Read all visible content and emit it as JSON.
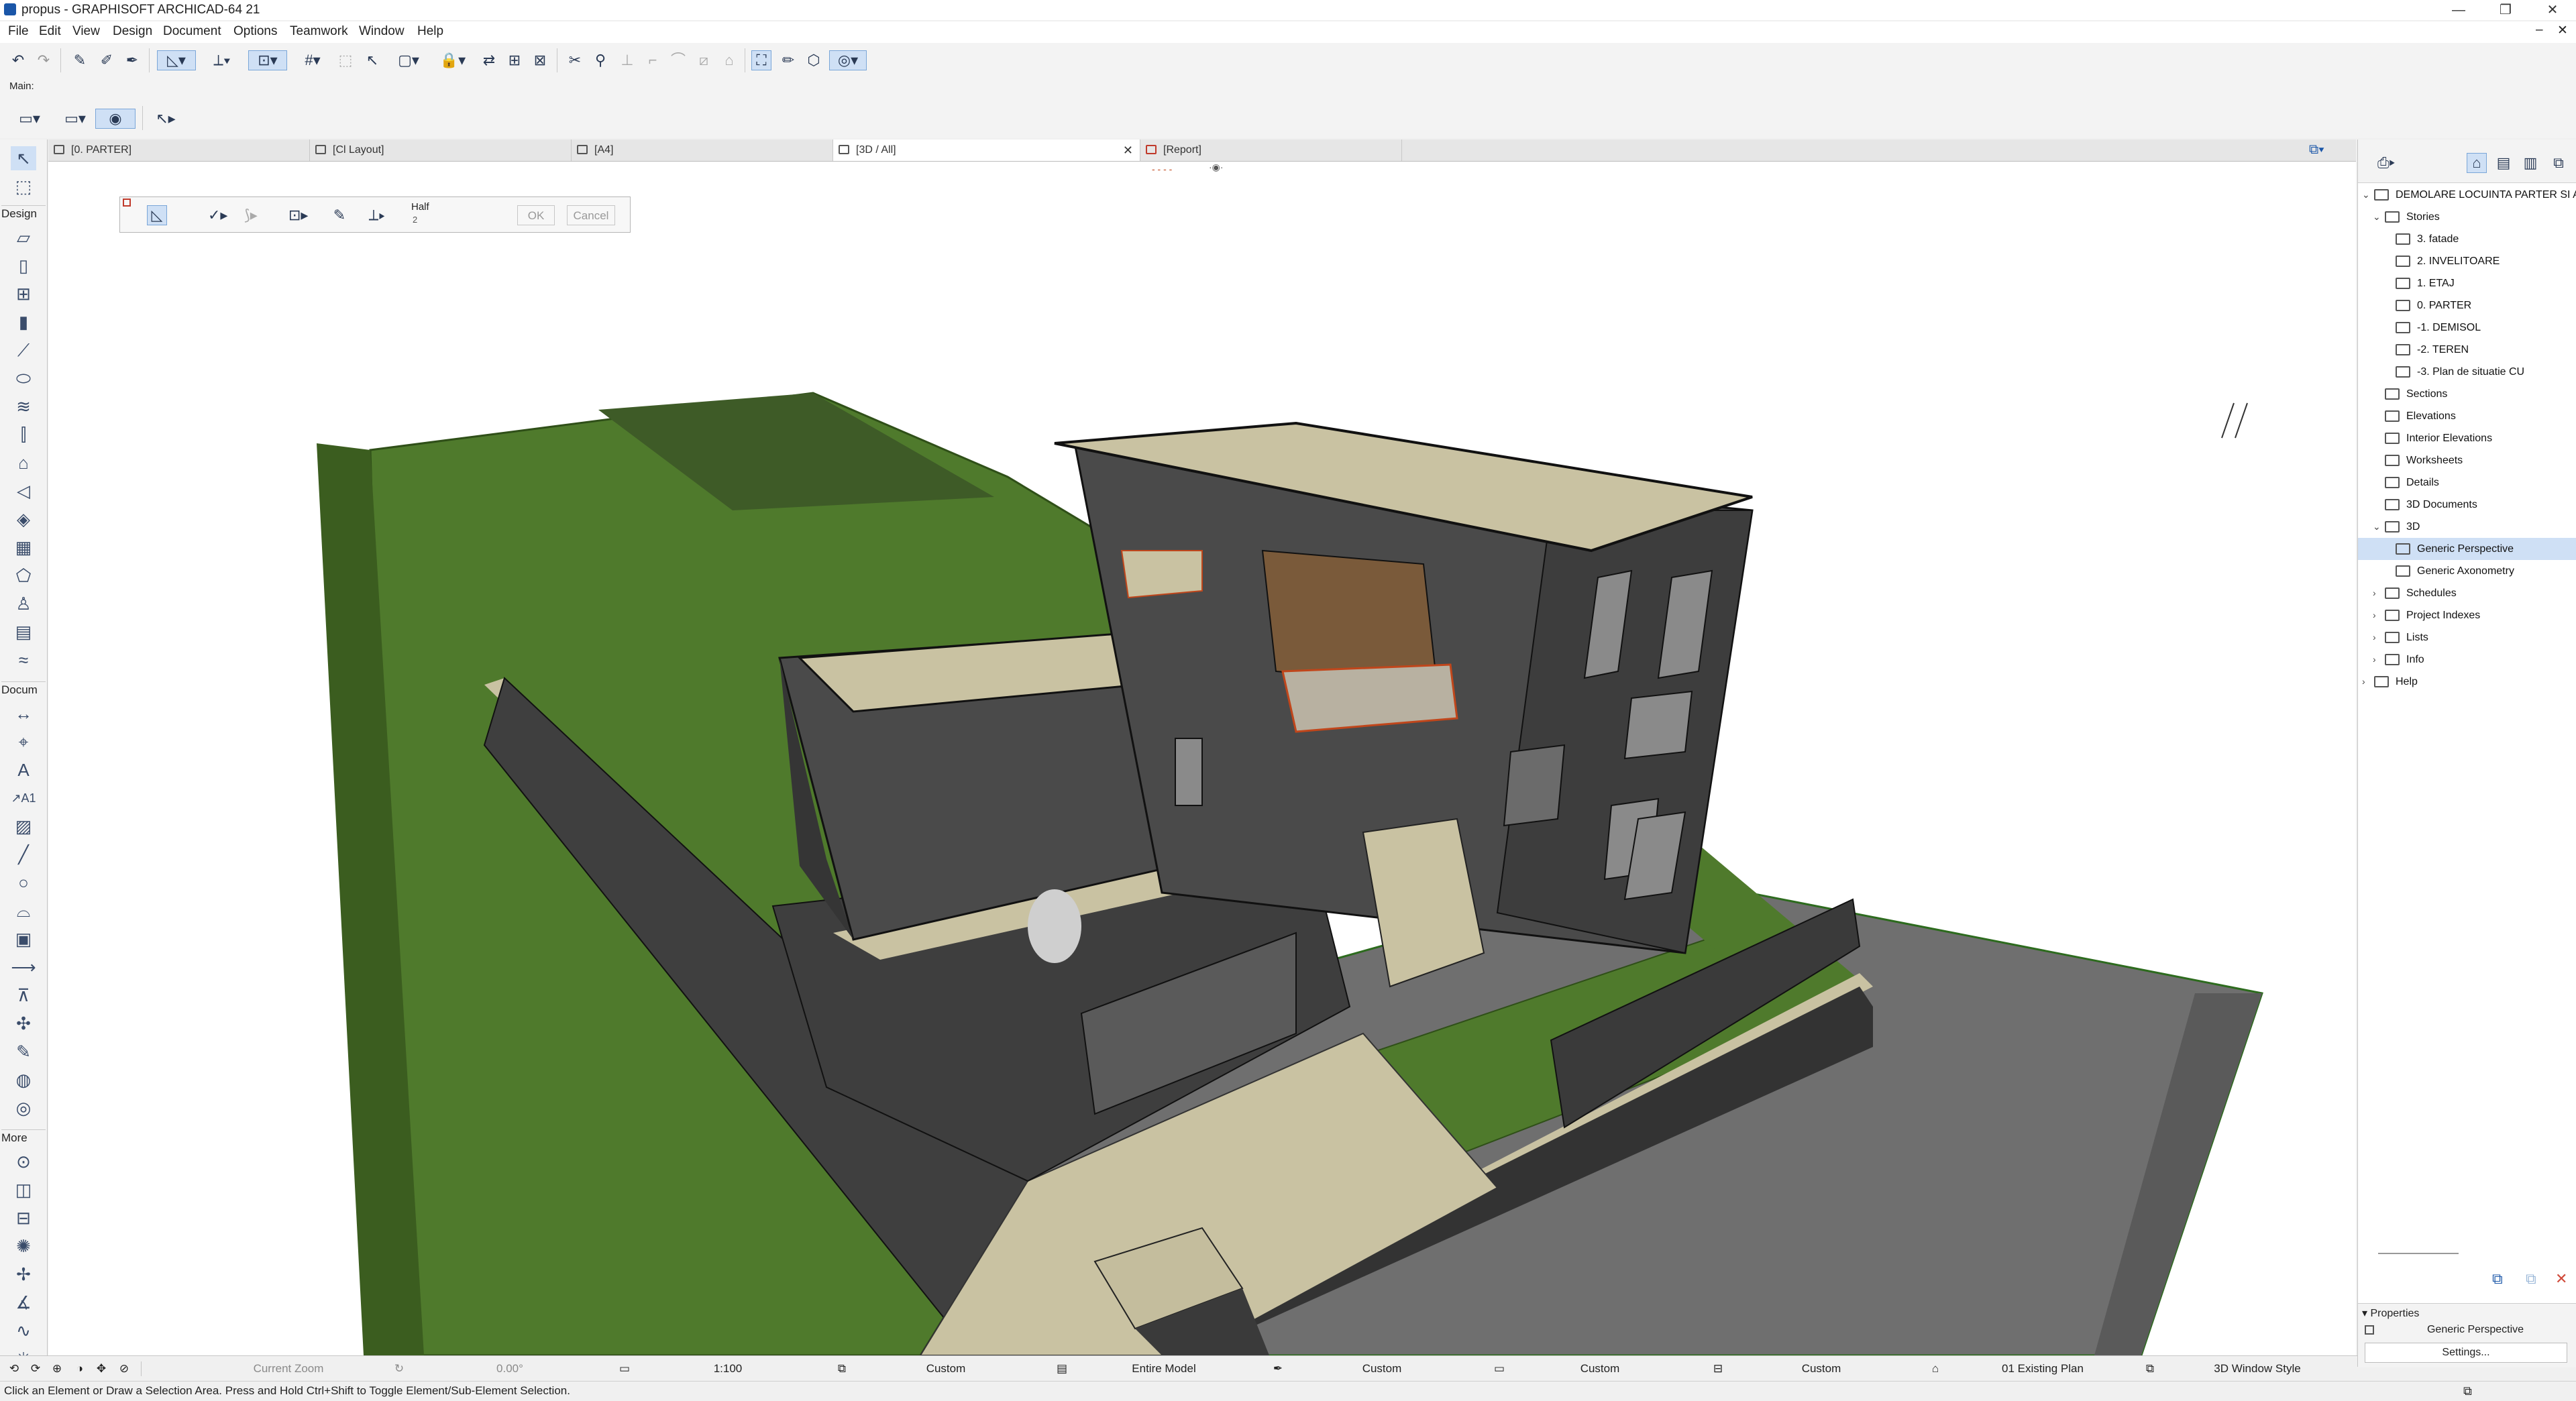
{
  "window": {
    "title": "propus - GRAPHISOFT ARCHICAD-64 21"
  },
  "menu": [
    "File",
    "Edit",
    "View",
    "Design",
    "Document",
    "Options",
    "Teamwork",
    "Window",
    "Help"
  ],
  "toolbar": {
    "main_label": "Main:"
  },
  "tabs": [
    {
      "label": "[0. PARTER]"
    },
    {
      "label": "[Cl Layout]"
    },
    {
      "label": "[A4]"
    },
    {
      "label": "[3D / All]"
    },
    {
      "label": "[Report]"
    }
  ],
  "toolbox": {
    "design": "Design",
    "document": "Docum",
    "more": "More"
  },
  "infobox": {
    "mode": "Half",
    "mode_sub": "2",
    "ok": "OK",
    "cancel": "Cancel"
  },
  "navigator": {
    "project": "DEMOLARE LOCUINTA PARTER SI A",
    "items": [
      {
        "label": "Stories"
      },
      {
        "label": "3. fatade"
      },
      {
        "label": "2. INVELITOARE"
      },
      {
        "label": "1. ETAJ"
      },
      {
        "label": "0. PARTER"
      },
      {
        "label": "-1. DEMISOL"
      },
      {
        "label": "-2. TEREN"
      },
      {
        "label": "-3. Plan de situatie CU"
      },
      {
        "label": "Sections"
      },
      {
        "label": "Elevations"
      },
      {
        "label": "Interior Elevations"
      },
      {
        "label": "Worksheets"
      },
      {
        "label": "Details"
      },
      {
        "label": "3D Documents"
      },
      {
        "label": "3D"
      },
      {
        "label": "Generic Perspective"
      },
      {
        "label": "Generic Axonometry"
      },
      {
        "label": "Schedules"
      },
      {
        "label": "Project Indexes"
      },
      {
        "label": "Lists"
      },
      {
        "label": "Info"
      },
      {
        "label": "Help"
      }
    ]
  },
  "properties": {
    "header": "Properties",
    "name": "Generic Perspective",
    "settings": "Settings..."
  },
  "bottom": {
    "zoom": "Current Zoom",
    "angle": "0.00°",
    "scale": "1:100",
    "layers": "Custom",
    "model": "Entire Model",
    "pens": "Custom",
    "mvo": "Custom",
    "dimensions": "Custom",
    "renovation": "01 Existing Plan",
    "style": "3D Window Style"
  },
  "status": "Click an Element or Draw a Selection Area. Press and Hold Ctrl+Shift to Toggle Element/Sub-Element Selection.",
  "colors": {
    "grass": "#4f7a2c",
    "wall": "#4a4a4a",
    "slab": "#c9c2a2",
    "ground": "#6e6e6e",
    "accent": "#1a56a8"
  }
}
